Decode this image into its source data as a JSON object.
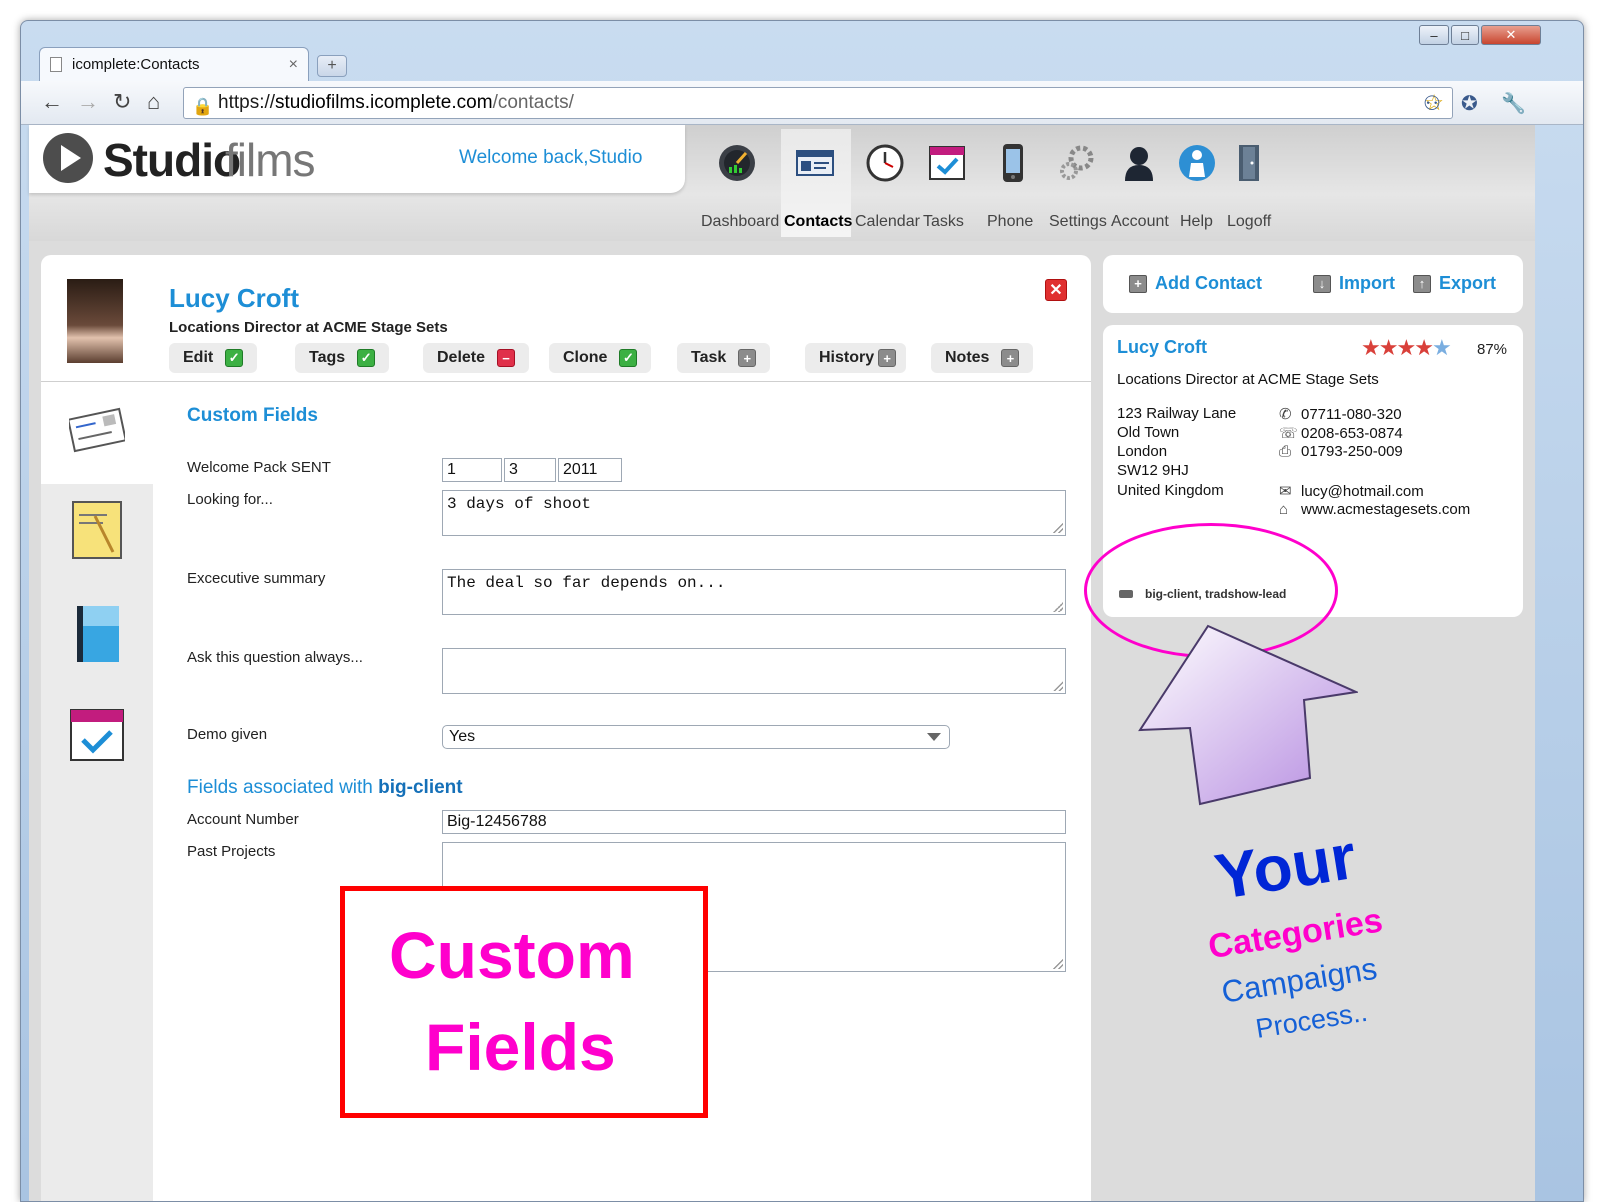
{
  "browser": {
    "tab_title": "icomplete:Contacts",
    "tab_close": "×",
    "new_tab": "+",
    "url_prefix": "https://",
    "url_host": "studiofilms.icomplete.com",
    "url_path": "/contacts/"
  },
  "app": {
    "logo_bold": "Studio",
    "logo_light": "films",
    "welcome": "Welcome back,Studio",
    "nav": [
      {
        "label": "Dashboard",
        "icon": "dashboard-icon"
      },
      {
        "label": "Contacts",
        "icon": "contacts-icon",
        "active": true
      },
      {
        "label": "Calendar",
        "icon": "calendar-clock-icon"
      },
      {
        "label": "Tasks",
        "icon": "tasks-icon"
      },
      {
        "label": "Phone",
        "icon": "phone-icon"
      },
      {
        "label": "Settings",
        "icon": "settings-gear-icon"
      },
      {
        "label": "Account",
        "icon": "account-person-icon"
      },
      {
        "label": "Help",
        "icon": "help-icon"
      },
      {
        "label": "Logoff",
        "icon": "logoff-door-icon"
      }
    ]
  },
  "contact": {
    "name": "Lucy Croft",
    "title": "Locations Director at ACME Stage Sets",
    "actions": [
      "Edit",
      "Tags",
      "Delete",
      "Clone",
      "Task",
      "History",
      "Notes"
    ]
  },
  "custom_fields": {
    "heading": "Custom Fields",
    "welcome_pack": {
      "label": "Welcome Pack SENT",
      "day": "1",
      "month": "3",
      "year": "2011"
    },
    "looking_for": {
      "label": "Looking for...",
      "value": "3 days of shoot"
    },
    "exec_summary": {
      "label": "Excecutive summary",
      "value": "The deal so far depends on..."
    },
    "ask_question": {
      "label": "Ask this question always...",
      "value": ""
    },
    "demo_given": {
      "label": "Demo given",
      "value": "Yes"
    }
  },
  "associated": {
    "heading_prefix": "Fields associated with ",
    "heading_tag": "big-client",
    "account_number": {
      "label": "Account Number",
      "value": "Big-12456788"
    },
    "past_projects": {
      "label": "Past Projects",
      "value": ""
    }
  },
  "right": {
    "add_contact": "Add Contact",
    "import": "Import",
    "export": "Export",
    "card": {
      "name": "Lucy Croft",
      "stars": 4.5,
      "rating": "87%",
      "title": "Locations Director at ACME Stage Sets",
      "address": [
        "123 Railway Lane",
        "Old Town",
        "London",
        "SW12 9HJ",
        "United Kingdom"
      ],
      "mobile": "07711-080-320",
      "phone": "0208-653-0874",
      "fax": "01793-250-009",
      "email": "lucy@hotmail.com",
      "website": "www.acmestagesets.com",
      "tags": "big-client,   tradshow-lead"
    }
  },
  "annotations": {
    "custom_line1": "Custom",
    "custom_line2": "Fields",
    "your": "Your",
    "categories": "Categories",
    "campaigns": "Campaigns",
    "process": "Process.."
  },
  "colors": {
    "accent": "#1d8ed6",
    "highlight": "#ff00cc",
    "callout_border": "#ff0000"
  }
}
